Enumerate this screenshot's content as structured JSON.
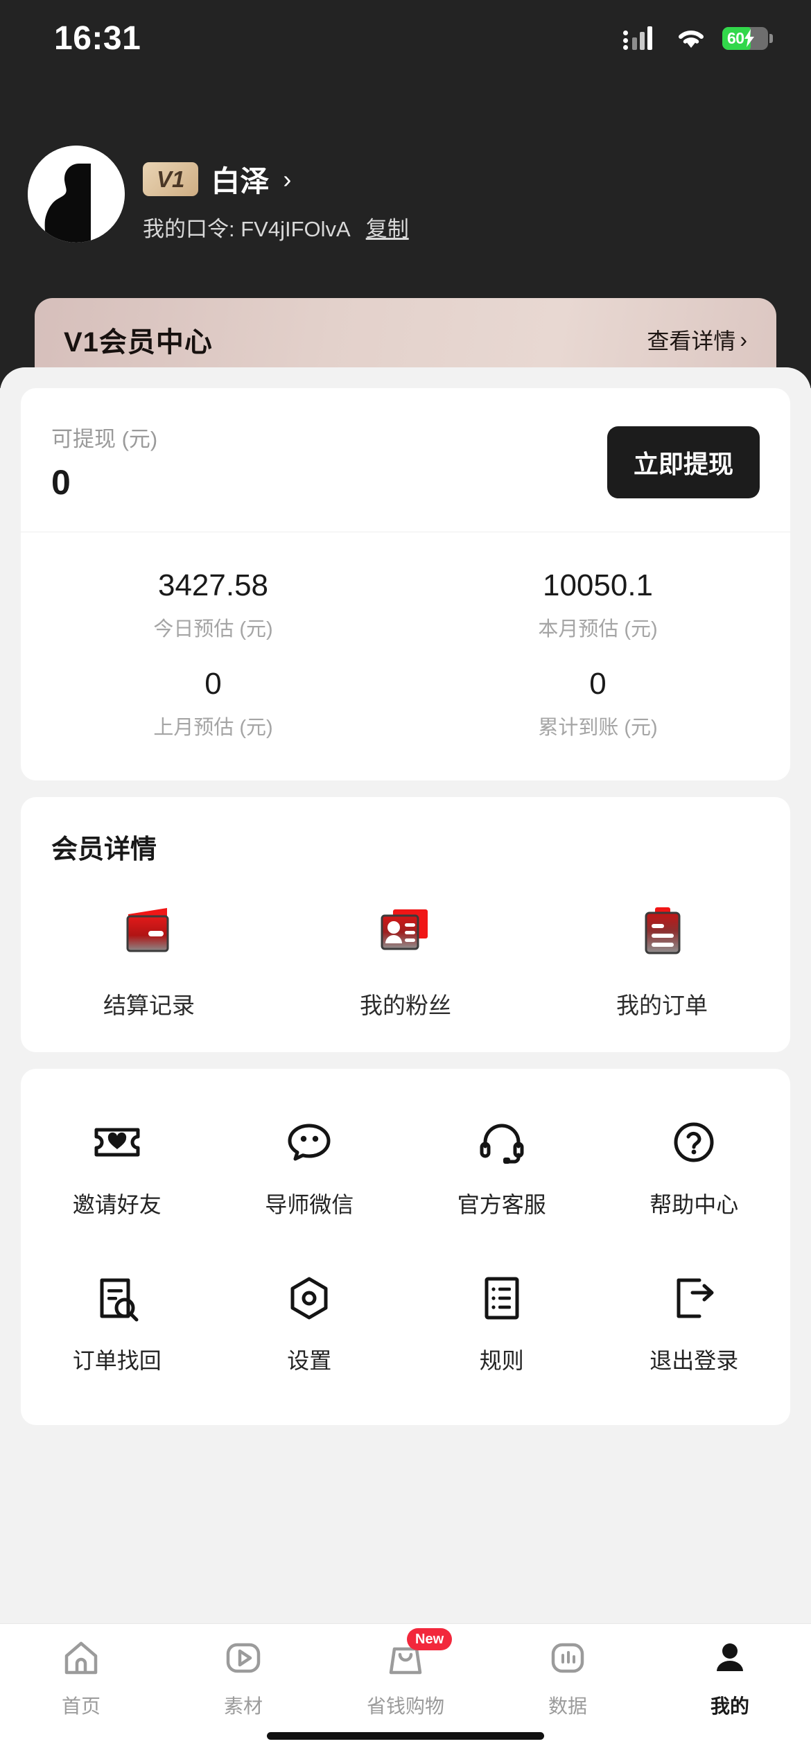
{
  "status_bar": {
    "time": "16:31",
    "battery_percent": "60",
    "icons": [
      "cellular-signal-icon",
      "wifi-icon",
      "battery-charging-icon"
    ]
  },
  "profile": {
    "avatar_icon": "user-silhouette-avatar",
    "level_badge": "V1",
    "username": "白泽",
    "chevron": "›",
    "code_label": "我的口令: FV4jIFOlvA",
    "copy_label": "复制"
  },
  "member_banner": {
    "title": "V1会员中心",
    "detail_label": "查看详情",
    "chevron": "›",
    "bg_color": "#e0cbc5"
  },
  "wallet": {
    "label": "可提现 (元)",
    "amount": "0",
    "withdraw_button": "立即提现",
    "button_color": "#1c1c1c"
  },
  "stats": [
    {
      "value": "3427.58",
      "label": "今日预估 (元)"
    },
    {
      "value": "10050.1",
      "label": "本月预估 (元)"
    },
    {
      "value": "0",
      "label": "上月预估 (元)"
    },
    {
      "value": "0",
      "label": "累计到账 (元)"
    }
  ],
  "member_section": {
    "title": "会员详情",
    "items": [
      {
        "label": "结算记录",
        "icon": "wallet-icon"
      },
      {
        "label": "我的粉丝",
        "icon": "id-card-icon"
      },
      {
        "label": "我的订单",
        "icon": "clipboard-order-icon"
      }
    ],
    "accent_color": "#e21a1a"
  },
  "tools": [
    {
      "label": "邀请好友",
      "icon": "ticket-heart-icon"
    },
    {
      "label": "导师微信",
      "icon": "wechat-bubble-icon"
    },
    {
      "label": "官方客服",
      "icon": "headset-icon"
    },
    {
      "label": "帮助中心",
      "icon": "question-circle-icon"
    },
    {
      "label": "订单找回",
      "icon": "document-search-icon"
    },
    {
      "label": "设置",
      "icon": "hexagon-gear-icon"
    },
    {
      "label": "规则",
      "icon": "list-document-icon"
    },
    {
      "label": "退出登录",
      "icon": "logout-icon"
    }
  ],
  "tabbar": [
    {
      "label": "首页",
      "icon": "home-icon",
      "active": false,
      "badge": ""
    },
    {
      "label": "素材",
      "icon": "video-play-icon",
      "active": false,
      "badge": ""
    },
    {
      "label": "省钱购物",
      "icon": "shopping-bag-icon",
      "active": false,
      "badge": "New"
    },
    {
      "label": "数据",
      "icon": "bar-chart-icon",
      "active": false,
      "badge": ""
    },
    {
      "label": "我的",
      "icon": "person-icon",
      "active": true,
      "badge": ""
    }
  ]
}
